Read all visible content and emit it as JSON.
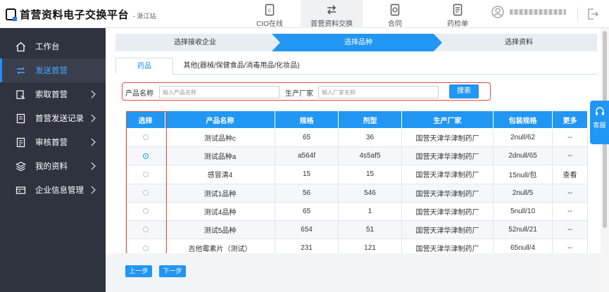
{
  "header": {
    "logo_title": "首营资料电子交换平台",
    "logo_sub": "- 浙江站",
    "nav": [
      {
        "label": "CIO在线",
        "icon": "document-icon"
      },
      {
        "label": "首营资料交换",
        "icon": "exchange-icon"
      },
      {
        "label": "合同",
        "icon": "contract-icon"
      },
      {
        "label": "药检单",
        "icon": "report-icon"
      }
    ],
    "active_nav": 1
  },
  "sidebar": {
    "items": [
      {
        "label": "工作台",
        "icon": "home-icon"
      },
      {
        "label": "发送首营",
        "icon": "send-icon"
      },
      {
        "label": "索取首营",
        "icon": "request-icon"
      },
      {
        "label": "首营发送记录",
        "icon": "record-icon"
      },
      {
        "label": "审核首营",
        "icon": "audit-icon"
      },
      {
        "label": "我的资料",
        "icon": "layers-icon"
      },
      {
        "label": "企业信息管理",
        "icon": "company-icon"
      }
    ],
    "active": 1
  },
  "steps": [
    "选择接收企业",
    "选择品种",
    "选择资料"
  ],
  "active_step": 1,
  "tabs": [
    "药品",
    "其他(器械/保健食品/消毒用品/化妆品)"
  ],
  "active_tab": 0,
  "search": {
    "name_label": "产品名称",
    "name_placeholder": "输入产品名称",
    "maker_label": "生产厂家",
    "maker_placeholder": "输入厂家名称",
    "button": "搜索"
  },
  "table": {
    "headers": [
      "选择",
      "产品名称",
      "规格",
      "剂型",
      "生产厂家",
      "包装规格",
      "更多"
    ],
    "rows": [
      {
        "checked": false,
        "name": "测试品种c",
        "spec": "65",
        "form": "36",
        "maker": "国营天津华津制药厂",
        "pack": "2null/62",
        "more": "--"
      },
      {
        "checked": true,
        "name": "测试品种a",
        "spec": "a564f",
        "form": "4s5af5",
        "maker": "国营天津华津制药厂",
        "pack": "2dnull/65",
        "more": "--"
      },
      {
        "checked": false,
        "name": "感冒清4",
        "spec": "15",
        "form": "15",
        "maker": "国营天津华津制药厂",
        "pack": "15null/包",
        "more": "查看"
      },
      {
        "checked": false,
        "name": "测试1品种",
        "spec": "56",
        "form": "546",
        "maker": "国营天津华津制药厂",
        "pack": "2null/5",
        "more": "--"
      },
      {
        "checked": false,
        "name": "测试4品种",
        "spec": "65",
        "form": "1",
        "maker": "国营天津华津制药厂",
        "pack": "5null/10",
        "more": "--"
      },
      {
        "checked": false,
        "name": "测试5品种",
        "spec": "654",
        "form": "51",
        "maker": "国营天津华津制药厂",
        "pack": "52null/21",
        "more": "--"
      },
      {
        "checked": false,
        "name": "吉他霉素片（测试）",
        "spec": "231",
        "form": "121",
        "maker": "国营天津华津制药厂",
        "pack": "65null/4",
        "more": "--"
      }
    ]
  },
  "footer": {
    "prev": "上一步",
    "next": "下一步"
  },
  "service": {
    "label": "客服"
  },
  "colors": {
    "primary": "#2196f3",
    "highlight": "#e54b3a",
    "sidebar": "#2f3340"
  }
}
